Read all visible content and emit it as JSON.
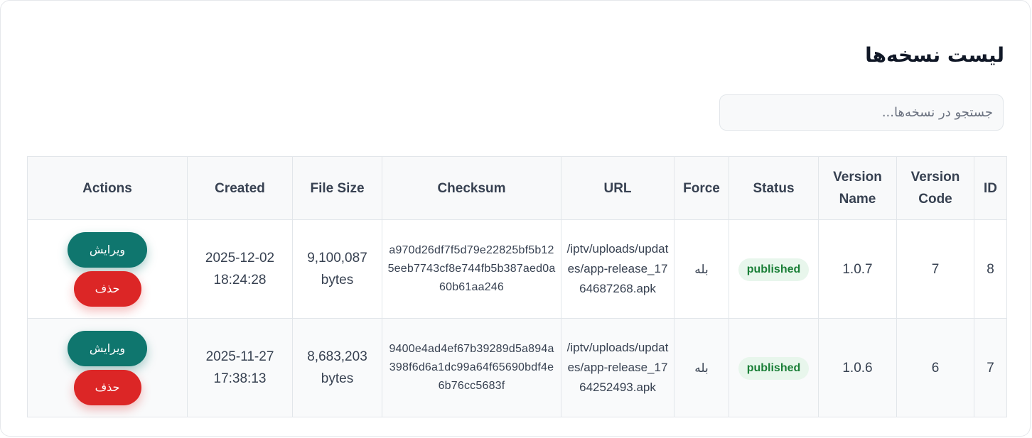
{
  "page": {
    "title": "لیست نسخه‌ها"
  },
  "search": {
    "placeholder": "جستجو در نسخه‌ها...",
    "value": ""
  },
  "table": {
    "headers": {
      "actions": "Actions",
      "created": "Created",
      "file_size": "File Size",
      "checksum": "Checksum",
      "url": "URL",
      "force": "Force",
      "status": "Status",
      "version_name": "Version Name",
      "version_code": "Version Code",
      "id": "ID"
    },
    "rows": [
      {
        "id": "8",
        "version_code": "7",
        "version_name": "1.0.7",
        "status": "published",
        "force": "بله",
        "url": "/iptv/uploads/updates/app-release_1764687268.apk",
        "checksum": "a970d26df7f5d79e22825bf5b125eeb7743cf8e744fb5b387aed0a60b61aa246",
        "file_size_value": "9,100,087",
        "file_size_unit": "bytes",
        "created_date": "2025-12-02",
        "created_time": "18:24:28",
        "edit_label": "ویرایش",
        "delete_label": "حذف"
      },
      {
        "id": "7",
        "version_code": "6",
        "version_name": "1.0.6",
        "status": "published",
        "force": "بله",
        "url": "/iptv/uploads/updates/app-release_1764252493.apk",
        "checksum": "9400e4ad4ef67b39289d5a894a398f6d6a1dc99a64f65690bdf4e6b76cc5683f",
        "file_size_value": "8,683,203",
        "file_size_unit": "bytes",
        "created_date": "2025-11-27",
        "created_time": "17:38:13",
        "edit_label": "ویرایش",
        "delete_label": "حذف"
      }
    ]
  },
  "colors": {
    "edit_button": "#0f766e",
    "delete_button": "#dc2626",
    "status_published_bg": "#e8f6ec",
    "status_published_text": "#1a7f37"
  }
}
